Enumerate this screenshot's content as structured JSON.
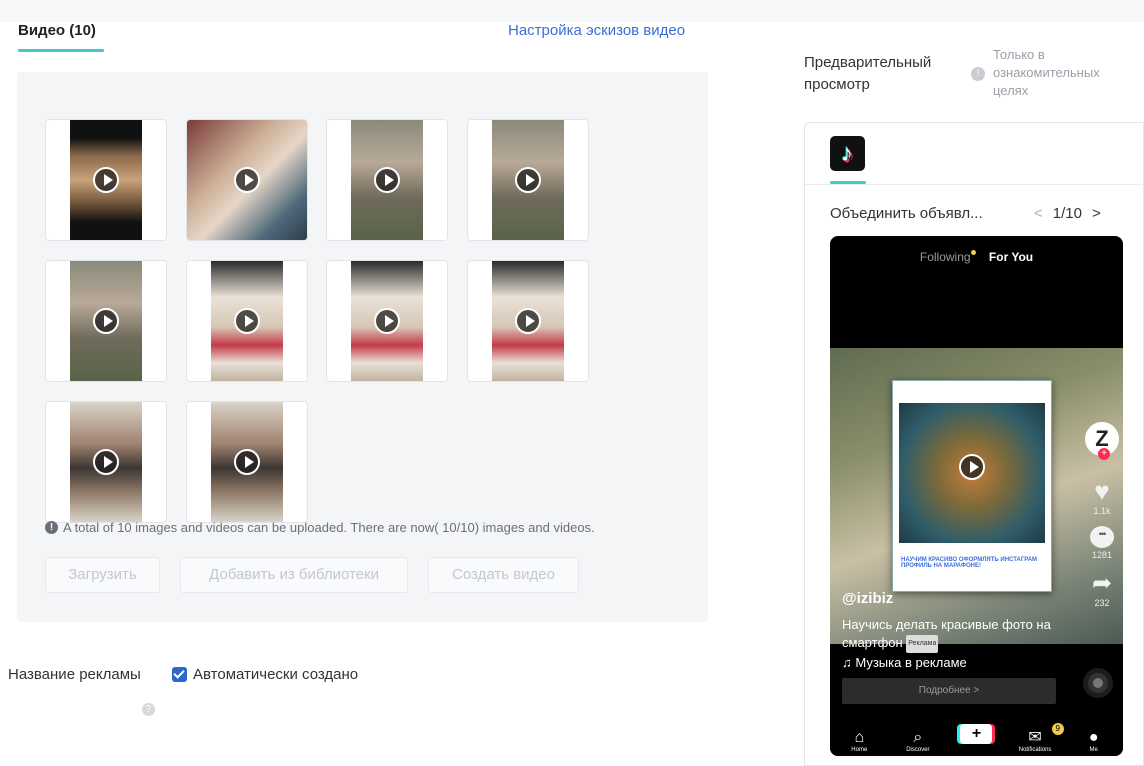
{
  "videos_tab": {
    "label": "Видео (10)"
  },
  "thumbnail_settings_link": "Настройка эскизов видео",
  "upload_notice": "A total of 10 images and videos can be uploaded. There are now( 10/10) images and videos.",
  "buttons": {
    "upload": "Загрузить",
    "add_from_library": "Добавить из библиотеки",
    "create_video": "Создать видео"
  },
  "ad_name": {
    "label": "Название рекламы",
    "auto_label": "Автоматически создано",
    "auto_checked": true
  },
  "preview": {
    "title": "Предварительный просмотр",
    "note": "Только в ознакомительных целях",
    "combine_label": "Объединить объявл...",
    "pager": "1/10"
  },
  "phone": {
    "tab_following": "Following",
    "tab_for_you": "For You",
    "handle": "@izibiz",
    "description": "Научись делать красивые фото на смартфон",
    "ad_badge": "Реклама",
    "music": "♫ Музыка в рекламе",
    "more_button": "Подробнее >",
    "likes": "1.1k",
    "comments": "1281",
    "shares": "232",
    "card_caption": "НАУЧИМ КРАСИВО ОФОРМЛЯТЬ ИНСТАГРАМ ПРОФИЛЬ НА МАРАФОНЕ!",
    "nav": {
      "home": "Home",
      "discover": "Discover",
      "notifications": "Notifications",
      "me": "Me",
      "notif_count": "9"
    }
  },
  "colors": {
    "accent_teal": "#45c6c9",
    "link_blue": "#3a6fd8",
    "checkbox_blue": "#2f66c9"
  }
}
